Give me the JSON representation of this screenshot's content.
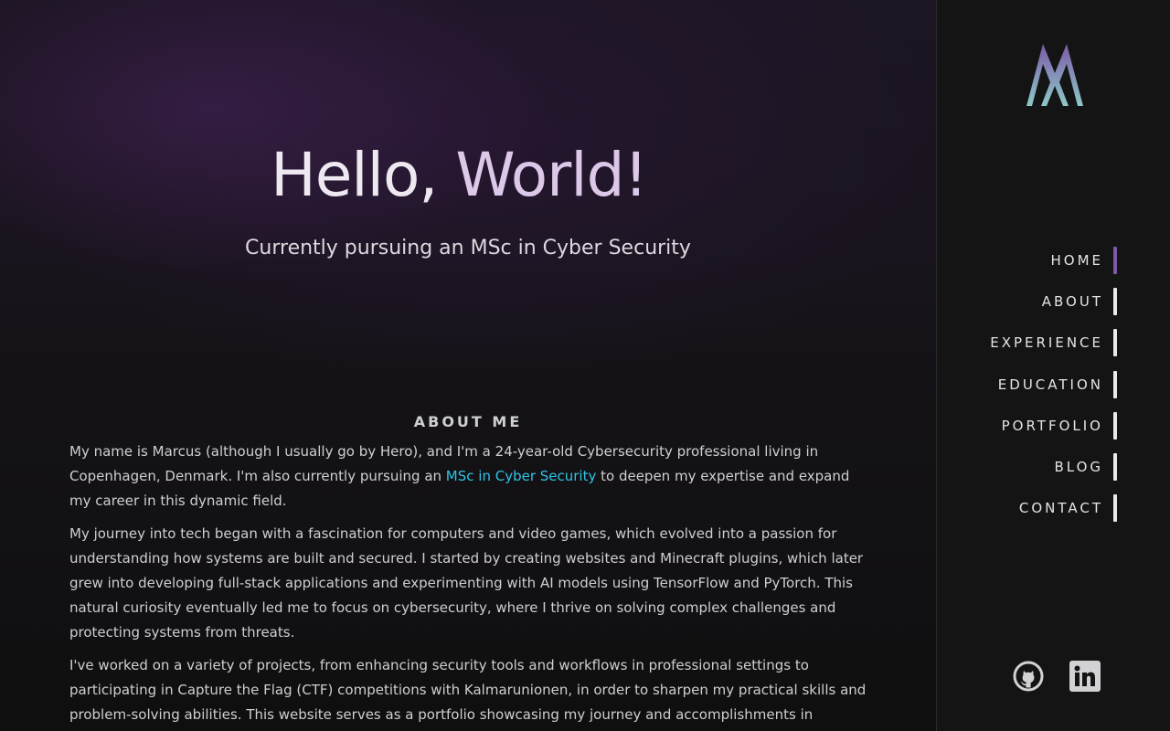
{
  "hero": {
    "title_part1": "Hello,",
    "title_part2": " World!",
    "subtitle": "Currently pursuing an MSc in Cyber Security"
  },
  "about": {
    "heading": "ABOUT ME",
    "p1_a": "My name is Marcus (although I usually go by Hero), and I'm a 24-year-old Cybersecurity professional living in Copenhagen, Denmark. I'm also currently pursuing an ",
    "p1_link": "MSc in Cyber Security",
    "p1_b": " to deepen my expertise and expand my career in this dynamic field.",
    "p2": "My journey into tech began with a fascination for computers and video games, which evolved into a passion for understanding how systems are built and secured. I started by creating websites and Minecraft plugins, which later grew into developing full-stack applications and experimenting with AI models using TensorFlow and PyTorch. This natural curiosity eventually led me to focus on cybersecurity, where I thrive on solving complex challenges and protecting systems from threats.",
    "p3": "I've worked on a variety of projects, from enhancing security tools and workflows in professional settings to participating in Capture the Flag (CTF) competitions with Kalmarunionen, in order to sharpen my practical skills and problem-solving abilities. This website serves as a portfolio showcasing my journey and accomplishments in"
  },
  "nav": {
    "items": [
      {
        "label": "HOME",
        "active": true
      },
      {
        "label": "ABOUT",
        "active": false
      },
      {
        "label": "EXPERIENCE",
        "active": false
      },
      {
        "label": "EDUCATION",
        "active": false
      },
      {
        "label": "PORTFOLIO",
        "active": false
      },
      {
        "label": "BLOG",
        "active": false
      },
      {
        "label": "CONTACT",
        "active": false
      }
    ]
  },
  "social": {
    "icons": [
      "github-icon",
      "linkedin-icon"
    ]
  },
  "colors": {
    "accent": "#7d5aa8",
    "link": "#2ec4e6",
    "background": "#111113"
  }
}
